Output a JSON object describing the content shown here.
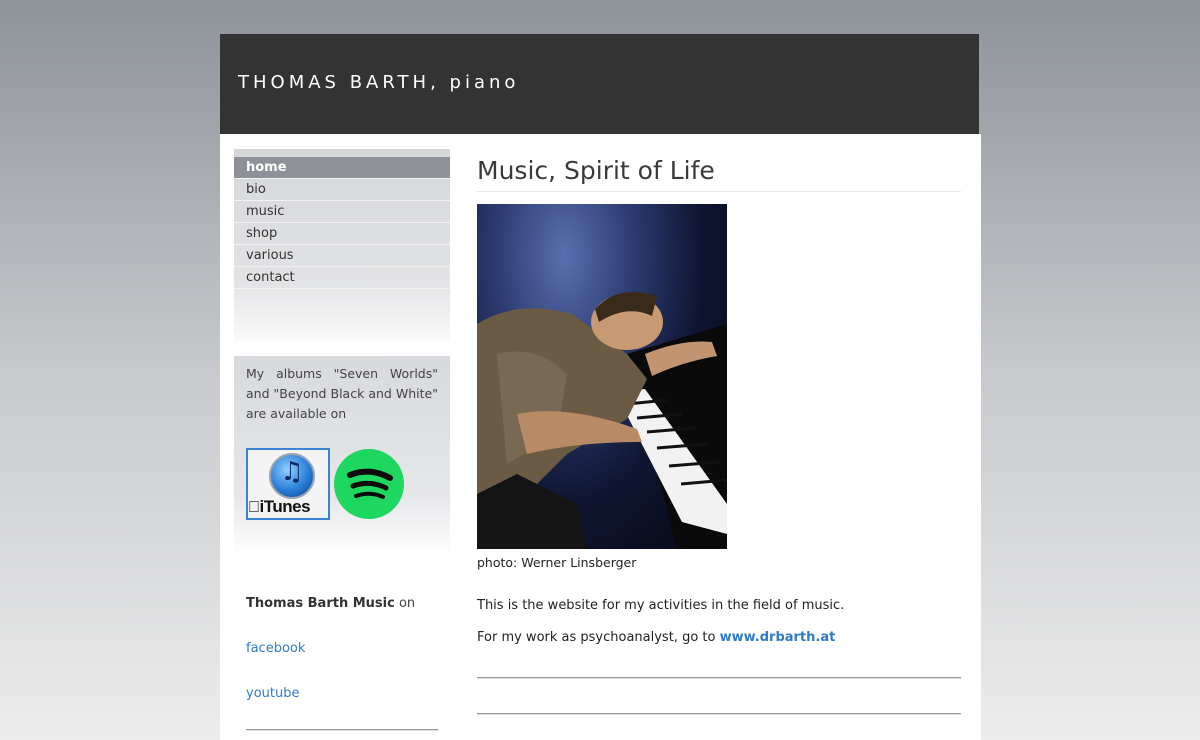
{
  "header": {
    "title": "THOMAS BARTH, piano"
  },
  "nav": {
    "items": [
      {
        "label": "home",
        "active": true
      },
      {
        "label": "bio"
      },
      {
        "label": "music"
      },
      {
        "label": "shop"
      },
      {
        "label": "various"
      },
      {
        "label": "contact"
      }
    ]
  },
  "sidebar": {
    "albums_text": "My albums \"Seven Worlds\" and \"Beyond Black and White\" are available on",
    "itunes_label": "iTunes",
    "social_name": "Thomas Barth Music",
    "social_suffix": " on",
    "links": [
      "facebook",
      "youtube"
    ]
  },
  "main": {
    "title": "Music, Spirit of Life",
    "photo_caption": "photo: Werner Linsberger",
    "para1": "This is the website for my activities in the field of music.",
    "para2_prefix": "For my work as psychoanalyst, go to ",
    "para2_link": "www.drbarth.at"
  },
  "colors": {
    "header_bg": "#333333",
    "nav_active_bg": "#8e9197",
    "link": "#2f7bc7",
    "spotify_green": "#1ed760"
  }
}
